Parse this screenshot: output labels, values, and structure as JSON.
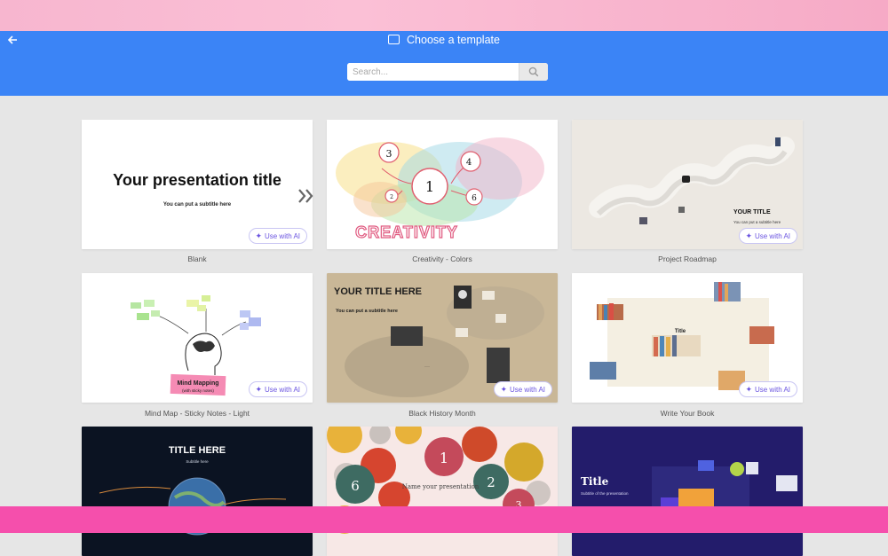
{
  "header": {
    "title": "Choose a template",
    "back_icon": "arrow-left-icon",
    "title_icon": "template-icon"
  },
  "search": {
    "placeholder": "Search...",
    "icon": "search-icon"
  },
  "colors": {
    "header_bg": "#3b84f6",
    "page_bg": "#e6e6e6",
    "ai_accent": "#6a54e0",
    "bottom_band": "#f54fac",
    "top_band": "#f7b6cf"
  },
  "ai_button_label": "Use with AI",
  "templates": [
    {
      "name": "Blank",
      "ai": true,
      "thumb_title": "Your presentation title",
      "thumb_subtitle": "You can put a subtitle here"
    },
    {
      "name": "Creativity - Colors",
      "ai": false,
      "thumb_title": "CREATIVITY",
      "thumb_numbers": [
        "3",
        "4",
        "1",
        "2",
        "6"
      ]
    },
    {
      "name": "Project Roadmap",
      "ai": true,
      "thumb_title": "YOUR TITLE",
      "thumb_subtitle": "You can put a subtitle here"
    },
    {
      "name": "Mind Map - Sticky Notes - Light",
      "ai": true,
      "thumb_title": "Mind Mapping",
      "thumb_subtitle": "(with sticky notes)"
    },
    {
      "name": "Black History Month",
      "ai": true,
      "thumb_title": "YOUR TITLE HERE",
      "thumb_subtitle": "You can put a subtitle here"
    },
    {
      "name": "Write Your Book",
      "ai": true,
      "thumb_title": "Title"
    },
    {
      "name": "",
      "ai": false,
      "thumb_title": "TITLE HERE",
      "thumb_subtitle": "Subtitle here"
    },
    {
      "name": "",
      "ai": false,
      "thumb_title": "Name your presentation",
      "thumb_numbers": [
        "1",
        "2",
        "6",
        "3"
      ]
    },
    {
      "name": "",
      "ai": false,
      "thumb_title": "Title",
      "thumb_subtitle": "Subtitle of the presentation"
    }
  ]
}
